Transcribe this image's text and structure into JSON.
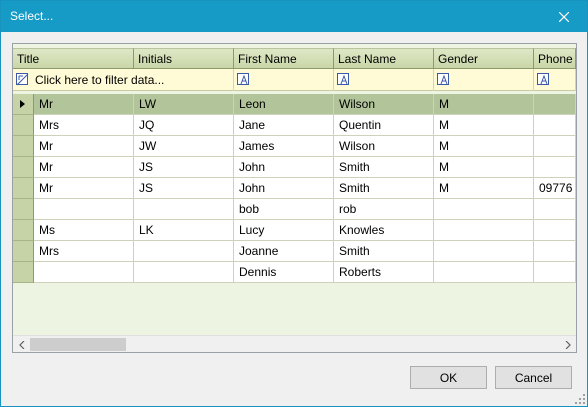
{
  "window": {
    "title": "Select..."
  },
  "grid": {
    "columns": [
      "Title",
      "Initials",
      "First Name",
      "Last Name",
      "Gender",
      "Phone"
    ],
    "filter_placeholder": "Click here to filter data...",
    "rows": [
      [
        "Mr",
        "LW",
        "Leon",
        "Wilson",
        "M",
        ""
      ],
      [
        "Mrs",
        "JQ",
        "Jane",
        "Quentin",
        "M",
        ""
      ],
      [
        "Mr",
        "JW",
        "James",
        "Wilson",
        "M",
        ""
      ],
      [
        "Mr",
        "JS",
        "John",
        "Smith",
        "M",
        ""
      ],
      [
        "Mr",
        "JS",
        "John",
        "Smith",
        "M",
        "09776"
      ],
      [
        "",
        "",
        "bob",
        "rob",
        "",
        ""
      ],
      [
        "Ms",
        "LK",
        "Lucy",
        "Knowles",
        "",
        ""
      ],
      [
        "Mrs",
        "",
        "Joanne",
        "Smith",
        "",
        ""
      ],
      [
        "",
        "",
        "Dennis",
        "Roberts",
        "",
        ""
      ]
    ],
    "selected_row": 0
  },
  "buttons": {
    "ok": "OK",
    "cancel": "Cancel"
  },
  "colors": {
    "titlebar": "#169ac6",
    "header": "#c9d6a8",
    "selected_row": "#b2c49a",
    "filter_row": "#fffbd6"
  },
  "icons": {
    "close": "close-icon",
    "filter": "filter-icon",
    "text_filter": "text-filter-icon"
  }
}
